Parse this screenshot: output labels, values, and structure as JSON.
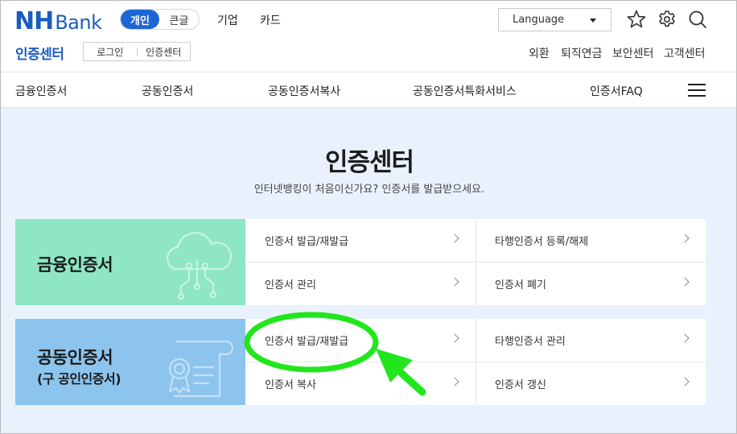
{
  "brand": {
    "logo_nh": "NH",
    "logo_bank": "Bank",
    "color": "#1a5cbf"
  },
  "segment": {
    "active": "개인",
    "inactive": "큰글",
    "active_color": "#1c66d4"
  },
  "top_links": [
    "기업",
    "카드"
  ],
  "language": {
    "label": "Language"
  },
  "header_icons": [
    "star-icon",
    "gear-icon",
    "search-icon"
  ],
  "sub_header": {
    "title": "인증센터",
    "breadcrumb": [
      "로그인",
      "인증센터"
    ],
    "utility_links": [
      "외환",
      "퇴직연금",
      "보안센터",
      "고객센터"
    ]
  },
  "gnb": {
    "items": [
      "금융인증서",
      "공동인증서",
      "공동인증서복사",
      "공동인증서특화서비스",
      "인증서FAQ"
    ],
    "menu_icon": "hamburger-icon"
  },
  "main": {
    "title": "인증센터",
    "description": "인터넷뱅킹이 처음이신가요? 인증서를 발급받으세요.",
    "background": "#e9f2fc"
  },
  "cards": [
    {
      "name": "금융인증서",
      "subname": "",
      "icon": "cloud-network-icon",
      "color": "#8ee6c4",
      "links": [
        "인증서 발급/재발급",
        "타행인증서 등록/해제",
        "인증서 관리",
        "인증서 폐기"
      ]
    },
    {
      "name": "공동인증서",
      "subname": "(구 공인인증서)",
      "icon": "certificate-scroll-icon",
      "color": "#8cc4ee",
      "links": [
        "인증서 발급/재발급",
        "타행인증서 관리",
        "인증서 복사",
        "인증서 갱신"
      ]
    }
  ],
  "annotation": {
    "highlight_color": "#22e61c",
    "target": "인증서 발급/재발급"
  }
}
